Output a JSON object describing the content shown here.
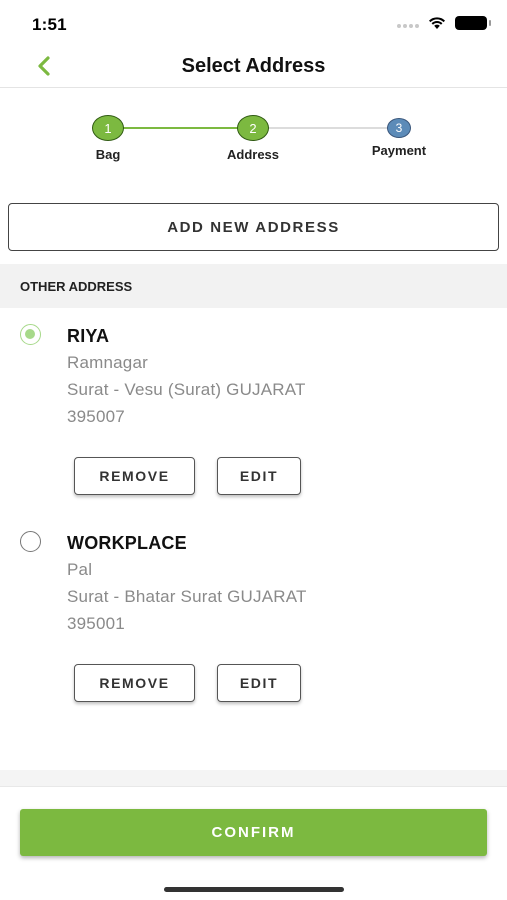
{
  "status_bar": {
    "time": "1:51"
  },
  "nav": {
    "title": "Select Address"
  },
  "stepper": {
    "steps": [
      {
        "number": "1",
        "label": "Bag"
      },
      {
        "number": "2",
        "label": "Address"
      },
      {
        "number": "3",
        "label": "Payment"
      }
    ]
  },
  "add_address_label": "ADD NEW ADDRESS",
  "section_header": "OTHER ADDRESS",
  "addresses": [
    {
      "name": "RIYA",
      "line1": "Ramnagar",
      "line2": "Surat - Vesu (Surat)  GUJARAT",
      "pincode": "395007",
      "selected": true,
      "remove_label": "REMOVE",
      "edit_label": "EDIT"
    },
    {
      "name": "WORKPLACE",
      "line1": "Pal",
      "line2": "Surat - Bhatar Surat  GUJARAT",
      "pincode": "395001",
      "selected": false,
      "remove_label": "REMOVE",
      "edit_label": "EDIT"
    }
  ],
  "confirm_label": "CONFIRM",
  "colors": {
    "accent": "#7cb940",
    "step_pending": "#5c8bb8",
    "radio_selected": "#a7d98a"
  },
  "icons": {
    "back": "chevron-left-icon",
    "wifi": "wifi-icon",
    "battery": "battery-icon",
    "signal": "signal-icon"
  }
}
